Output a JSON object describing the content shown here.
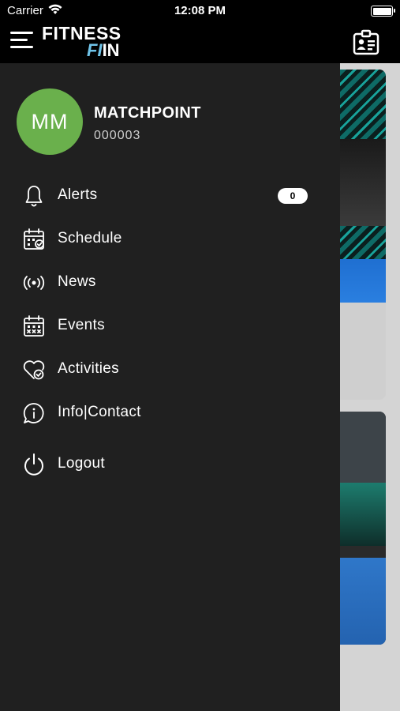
{
  "status_bar": {
    "carrier": "Carrier",
    "time": "12:08 PM"
  },
  "header": {
    "logo_line1": "FITNESS",
    "logo_line2_accent": "FI",
    "logo_line2_rest": "IN"
  },
  "user": {
    "initials": "MM",
    "name": "MATCHPOINT",
    "id": "000003"
  },
  "menu": [
    {
      "label": "Alerts",
      "icon": "bell-icon",
      "badge": "0"
    },
    {
      "label": "Schedule",
      "icon": "calendar-check-icon"
    },
    {
      "label": "News",
      "icon": "broadcast-icon"
    },
    {
      "label": "Events",
      "icon": "calendar-grid-icon"
    },
    {
      "label": "Activities",
      "icon": "heart-check-icon"
    },
    {
      "label": "Info|Contact",
      "icon": "info-chat-icon"
    },
    {
      "label": "Logout",
      "icon": "power-icon"
    }
  ],
  "colors": {
    "avatar": "#6ab04c",
    "drawer": "#202020",
    "accent": "#6fc3e8"
  }
}
